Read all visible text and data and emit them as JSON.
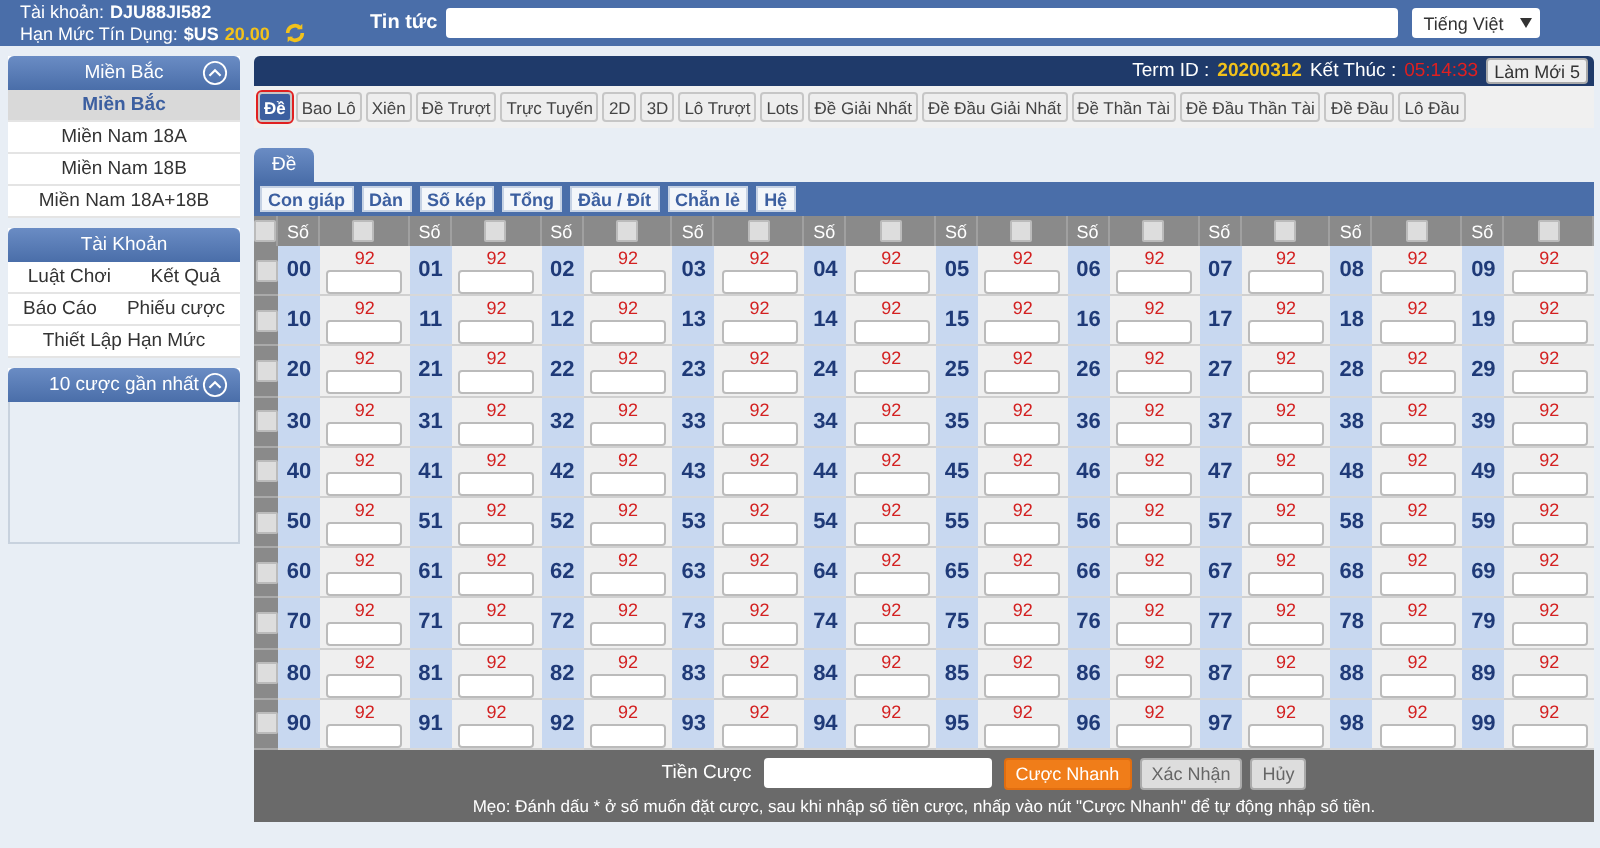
{
  "header": {
    "account_label": "Tài khoản:",
    "account": "DJU88JI582",
    "credit_label": "Hạn Mức Tín Dụng:",
    "currency": "$US",
    "credit": "20.00",
    "news_label": "Tin tức",
    "language": "Tiếng Việt"
  },
  "sidebar": [
    {
      "title": "Miền Bắc",
      "collapsible": true,
      "kind": "list",
      "items": [
        {
          "label": "Miền Bắc",
          "selected": true
        },
        {
          "label": "Miền Nam 18A",
          "selected": false
        },
        {
          "label": "Miền Nam 18B",
          "selected": false
        },
        {
          "label": "Miền Nam 18A+18B",
          "selected": false
        }
      ]
    },
    {
      "title": "Tài Khoản",
      "collapsible": false,
      "kind": "links",
      "rows": [
        [
          "Luật Chơi",
          "Kết Quả"
        ],
        [
          "Báo Cáo",
          "Phiếu cược"
        ],
        [
          "Thiết Lập Hạn Mức"
        ]
      ]
    },
    {
      "title": "10 cược gần nhất",
      "collapsible": true,
      "kind": "empty"
    }
  ],
  "term": {
    "label": "Term ID :",
    "id": "20200312",
    "end_label": "Kết Thúc :",
    "time": "05:14:33",
    "refresh": "Làm Mới 5"
  },
  "games": [
    {
      "label": "Đề",
      "selected": true
    },
    {
      "label": "Bao Lô",
      "selected": false
    },
    {
      "label": "Xiên",
      "selected": false
    },
    {
      "label": "Đề Trượt",
      "selected": false
    },
    {
      "label": "Trực Tuyến",
      "selected": false
    },
    {
      "label": "2D",
      "selected": false
    },
    {
      "label": "3D",
      "selected": false
    },
    {
      "label": "Lô Trượt",
      "selected": false
    },
    {
      "label": "Lots",
      "selected": false
    },
    {
      "label": "Đề Giải Nhất",
      "selected": false
    },
    {
      "label": "Đề Đầu Giải Nhất",
      "selected": false
    },
    {
      "label": "Đề Thần Tài",
      "selected": false
    },
    {
      "label": "Đề Đầu Thần Tài",
      "selected": false
    },
    {
      "label": "Đề Đầu",
      "selected": false
    },
    {
      "label": "Lô Đầu",
      "selected": false
    }
  ],
  "panel_tab": "Đề",
  "bet_types": [
    "Con giáp",
    "Dàn",
    "Số kép",
    "Tổng",
    "Đầu / Đít",
    "Chẵn lẻ",
    "Hệ"
  ],
  "table": {
    "select_all_checked": false,
    "header_groups": [
      {
        "label": "Số",
        "checked": false
      },
      {
        "label": "Số",
        "checked": false
      },
      {
        "label": "Số",
        "checked": false
      },
      {
        "label": "Số",
        "checked": false
      },
      {
        "label": "Số",
        "checked": false
      },
      {
        "label": "Số",
        "checked": false
      },
      {
        "label": "Số",
        "checked": false
      },
      {
        "label": "Số",
        "checked": false
      },
      {
        "label": "Số",
        "checked": false
      },
      {
        "label": "Số",
        "checked": false
      }
    ],
    "rows": [
      {
        "checked": false,
        "cells": [
          {
            "number": "00",
            "rate": "92"
          },
          {
            "number": "01",
            "rate": "92"
          },
          {
            "number": "02",
            "rate": "92"
          },
          {
            "number": "03",
            "rate": "92"
          },
          {
            "number": "04",
            "rate": "92"
          },
          {
            "number": "05",
            "rate": "92"
          },
          {
            "number": "06",
            "rate": "92"
          },
          {
            "number": "07",
            "rate": "92"
          },
          {
            "number": "08",
            "rate": "92"
          },
          {
            "number": "09",
            "rate": "92"
          }
        ]
      },
      {
        "checked": false,
        "cells": [
          {
            "number": "10",
            "rate": "92"
          },
          {
            "number": "11",
            "rate": "92"
          },
          {
            "number": "12",
            "rate": "92"
          },
          {
            "number": "13",
            "rate": "92"
          },
          {
            "number": "14",
            "rate": "92"
          },
          {
            "number": "15",
            "rate": "92"
          },
          {
            "number": "16",
            "rate": "92"
          },
          {
            "number": "17",
            "rate": "92"
          },
          {
            "number": "18",
            "rate": "92"
          },
          {
            "number": "19",
            "rate": "92"
          }
        ]
      },
      {
        "checked": false,
        "cells": [
          {
            "number": "20",
            "rate": "92"
          },
          {
            "number": "21",
            "rate": "92"
          },
          {
            "number": "22",
            "rate": "92"
          },
          {
            "number": "23",
            "rate": "92"
          },
          {
            "number": "24",
            "rate": "92"
          },
          {
            "number": "25",
            "rate": "92"
          },
          {
            "number": "26",
            "rate": "92"
          },
          {
            "number": "27",
            "rate": "92"
          },
          {
            "number": "28",
            "rate": "92"
          },
          {
            "number": "29",
            "rate": "92"
          }
        ]
      },
      {
        "checked": false,
        "cells": [
          {
            "number": "30",
            "rate": "92"
          },
          {
            "number": "31",
            "rate": "92"
          },
          {
            "number": "32",
            "rate": "92"
          },
          {
            "number": "33",
            "rate": "92"
          },
          {
            "number": "34",
            "rate": "92"
          },
          {
            "number": "35",
            "rate": "92"
          },
          {
            "number": "36",
            "rate": "92"
          },
          {
            "number": "37",
            "rate": "92"
          },
          {
            "number": "38",
            "rate": "92"
          },
          {
            "number": "39",
            "rate": "92"
          }
        ]
      },
      {
        "checked": false,
        "cells": [
          {
            "number": "40",
            "rate": "92"
          },
          {
            "number": "41",
            "rate": "92"
          },
          {
            "number": "42",
            "rate": "92"
          },
          {
            "number": "43",
            "rate": "92"
          },
          {
            "number": "44",
            "rate": "92"
          },
          {
            "number": "45",
            "rate": "92"
          },
          {
            "number": "46",
            "rate": "92"
          },
          {
            "number": "47",
            "rate": "92"
          },
          {
            "number": "48",
            "rate": "92"
          },
          {
            "number": "49",
            "rate": "92"
          }
        ]
      },
      {
        "checked": false,
        "cells": [
          {
            "number": "50",
            "rate": "92"
          },
          {
            "number": "51",
            "rate": "92"
          },
          {
            "number": "52",
            "rate": "92"
          },
          {
            "number": "53",
            "rate": "92"
          },
          {
            "number": "54",
            "rate": "92"
          },
          {
            "number": "55",
            "rate": "92"
          },
          {
            "number": "56",
            "rate": "92"
          },
          {
            "number": "57",
            "rate": "92"
          },
          {
            "number": "58",
            "rate": "92"
          },
          {
            "number": "59",
            "rate": "92"
          }
        ]
      },
      {
        "checked": false,
        "cells": [
          {
            "number": "60",
            "rate": "92"
          },
          {
            "number": "61",
            "rate": "92"
          },
          {
            "number": "62",
            "rate": "92"
          },
          {
            "number": "63",
            "rate": "92"
          },
          {
            "number": "64",
            "rate": "92"
          },
          {
            "number": "65",
            "rate": "92"
          },
          {
            "number": "66",
            "rate": "92"
          },
          {
            "number": "67",
            "rate": "92"
          },
          {
            "number": "68",
            "rate": "92"
          },
          {
            "number": "69",
            "rate": "92"
          }
        ]
      },
      {
        "checked": false,
        "cells": [
          {
            "number": "70",
            "rate": "92"
          },
          {
            "number": "71",
            "rate": "92"
          },
          {
            "number": "72",
            "rate": "92"
          },
          {
            "number": "73",
            "rate": "92"
          },
          {
            "number": "74",
            "rate": "92"
          },
          {
            "number": "75",
            "rate": "92"
          },
          {
            "number": "76",
            "rate": "92"
          },
          {
            "number": "77",
            "rate": "92"
          },
          {
            "number": "78",
            "rate": "92"
          },
          {
            "number": "79",
            "rate": "92"
          }
        ]
      },
      {
        "checked": false,
        "cells": [
          {
            "number": "80",
            "rate": "92"
          },
          {
            "number": "81",
            "rate": "92"
          },
          {
            "number": "82",
            "rate": "92"
          },
          {
            "number": "83",
            "rate": "92"
          },
          {
            "number": "84",
            "rate": "92"
          },
          {
            "number": "85",
            "rate": "92"
          },
          {
            "number": "86",
            "rate": "92"
          },
          {
            "number": "87",
            "rate": "92"
          },
          {
            "number": "88",
            "rate": "92"
          },
          {
            "number": "89",
            "rate": "92"
          }
        ]
      },
      {
        "checked": false,
        "cells": [
          {
            "number": "90",
            "rate": "92"
          },
          {
            "number": "91",
            "rate": "92"
          },
          {
            "number": "92",
            "rate": "92"
          },
          {
            "number": "93",
            "rate": "92"
          },
          {
            "number": "94",
            "rate": "92"
          },
          {
            "number": "95",
            "rate": "92"
          },
          {
            "number": "96",
            "rate": "92"
          },
          {
            "number": "97",
            "rate": "92"
          },
          {
            "number": "98",
            "rate": "92"
          },
          {
            "number": "99",
            "rate": "92"
          }
        ]
      }
    ]
  },
  "footer": {
    "amount_label": "Tiền Cược",
    "buttons": [
      {
        "label": "Cược Nhanh",
        "kind": "primary"
      },
      {
        "label": "Xác Nhận",
        "kind": "normal"
      },
      {
        "label": "Hủy",
        "kind": "normal"
      }
    ],
    "tip": "Mẹo: Đánh dấu * ở số muốn đặt cược, sau khi nhập số tiền cược, nhấp vào nút \"Cược Nhanh\" để tự động nhập số tiền."
  }
}
